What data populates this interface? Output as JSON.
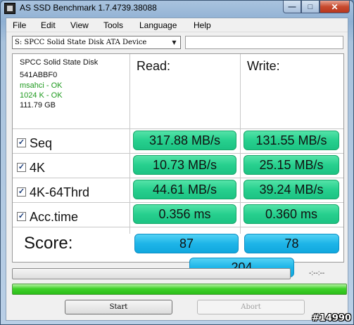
{
  "window": {
    "title": "AS SSD Benchmark 1.7.4739.38088"
  },
  "menu": [
    "File",
    "Edit",
    "View",
    "Tools",
    "Language",
    "Help"
  ],
  "drive_select": {
    "value": "S: SPCC Solid State Disk ATA Device"
  },
  "drive_info": {
    "model": "SPCC Solid State Disk",
    "firmware": "541ABBF0",
    "driver_status": "msahci - OK",
    "alignment_status": "1024 K - OK",
    "capacity": "111.79 GB"
  },
  "columns": {
    "read": "Read:",
    "write": "Write:"
  },
  "tests": [
    {
      "label": "Seq",
      "checked": true,
      "read": "317.88 MB/s",
      "write": "131.55 MB/s"
    },
    {
      "label": "4K",
      "checked": true,
      "read": "10.73 MB/s",
      "write": "25.15 MB/s"
    },
    {
      "label": "4K-64Thrd",
      "checked": true,
      "read": "44.61 MB/s",
      "write": "39.24 MB/s"
    },
    {
      "label": "Acc.time",
      "checked": true,
      "read": "0.356 ms",
      "write": "0.360 ms"
    }
  ],
  "score": {
    "label": "Score:",
    "read": "87",
    "write": "78",
    "total": "204"
  },
  "progress": {
    "time_readout": "-:--:--",
    "overall_fraction": 1.0,
    "current_fraction": 0.0
  },
  "buttons": {
    "start": "Start",
    "abort": "Abort"
  },
  "watermark": "#14990",
  "colors": {
    "value_box": "#27d08e",
    "score_box": "#1eb5e8",
    "progress": "#3fd12a",
    "ok_text": "#1e9a1e"
  }
}
